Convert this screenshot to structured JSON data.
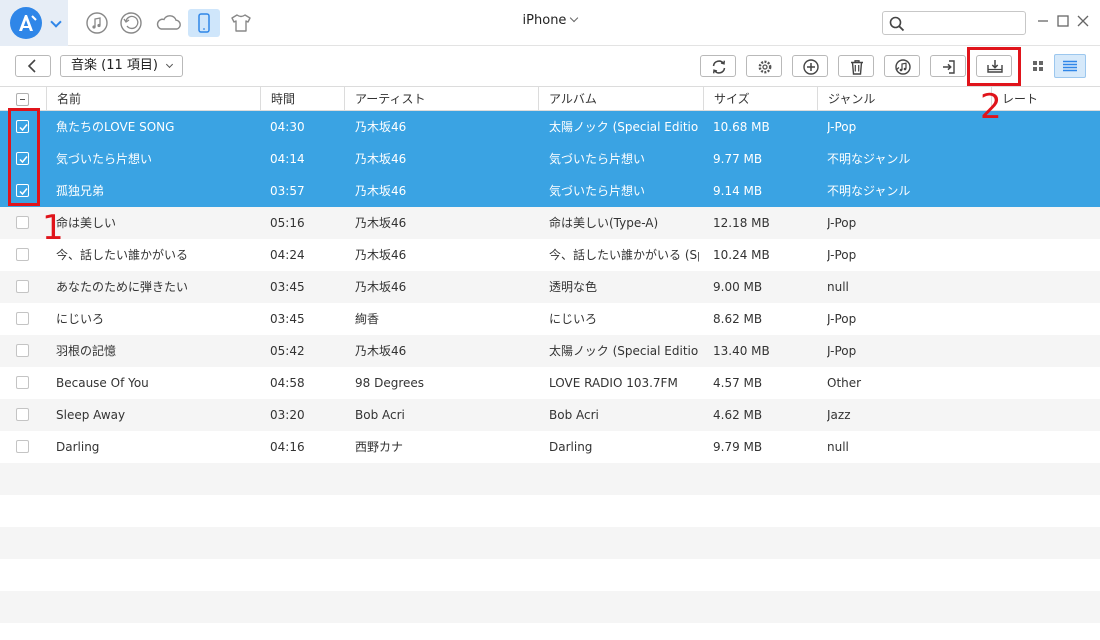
{
  "app": {
    "device_name": "iPhone",
    "accent": "#3aa3e3",
    "highlight": "#e0141b",
    "nav_icons": [
      "music-note-icon",
      "history-icon",
      "cloud-icon",
      "phone-icon",
      "shirt-icon"
    ]
  },
  "search": {
    "placeholder": "",
    "value": ""
  },
  "toolbar": {
    "category": "音楽 (11 項目)",
    "buttons": [
      "refresh-icon",
      "settings-icon",
      "add-icon",
      "delete-icon",
      "itunes-icon",
      "import-icon",
      "export-to-pc-icon"
    ],
    "view_modes": [
      "grid-view-icon",
      "list-view-icon"
    ],
    "active_view": "list"
  },
  "annotations": {
    "one": "1",
    "two": "2"
  },
  "table": {
    "headers": {
      "name": "名前",
      "time": "時間",
      "artist": "アーティスト",
      "album": "アルバム",
      "size": "サイズ",
      "genre": "ジャンル",
      "rate": "レート"
    },
    "rows": [
      {
        "selected": true,
        "name": "魚たちのLOVE SONG",
        "time": "04:30",
        "artist": "乃木坂46",
        "album": "太陽ノック (Special Edition)",
        "size": "10.68 MB",
        "genre": "J-Pop"
      },
      {
        "selected": true,
        "name": "気づいたら片想い",
        "time": "04:14",
        "artist": "乃木坂46",
        "album": "気づいたら片想い",
        "size": "9.77 MB",
        "genre": "不明なジャンル"
      },
      {
        "selected": true,
        "name": "孤独兄弟",
        "time": "03:57",
        "artist": "乃木坂46",
        "album": "気づいたら片想い",
        "size": "9.14 MB",
        "genre": "不明なジャンル"
      },
      {
        "selected": false,
        "name": "命は美しい",
        "time": "05:16",
        "artist": "乃木坂46",
        "album": "命は美しい(Type-A)",
        "size": "12.18 MB",
        "genre": "J-Pop"
      },
      {
        "selected": false,
        "name": "今、話したい誰かがいる",
        "time": "04:24",
        "artist": "乃木坂46",
        "album": "今、話したい誰かがいる (Sp...",
        "size": "10.24 MB",
        "genre": "J-Pop"
      },
      {
        "selected": false,
        "name": "あなたのために弾きたい",
        "time": "03:45",
        "artist": "乃木坂46",
        "album": "透明な色",
        "size": "9.00 MB",
        "genre": "null"
      },
      {
        "selected": false,
        "name": "にじいろ",
        "time": "03:45",
        "artist": "絢香",
        "album": "にじいろ",
        "size": "8.62 MB",
        "genre": "J-Pop"
      },
      {
        "selected": false,
        "name": "羽根の記憶",
        "time": "05:42",
        "artist": "乃木坂46",
        "album": "太陽ノック (Special Edition)",
        "size": "13.40 MB",
        "genre": "J-Pop"
      },
      {
        "selected": false,
        "name": "Because Of You",
        "time": "04:58",
        "artist": "98 Degrees",
        "album": "LOVE RADIO 103.7FM",
        "size": "4.57 MB",
        "genre": "Other"
      },
      {
        "selected": false,
        "name": "Sleep Away",
        "time": "03:20",
        "artist": "Bob Acri",
        "album": "Bob Acri",
        "size": "4.62 MB",
        "genre": "Jazz"
      },
      {
        "selected": false,
        "name": "Darling",
        "time": "04:16",
        "artist": "西野カナ",
        "album": "Darling",
        "size": "9.79 MB",
        "genre": "null"
      }
    ]
  }
}
